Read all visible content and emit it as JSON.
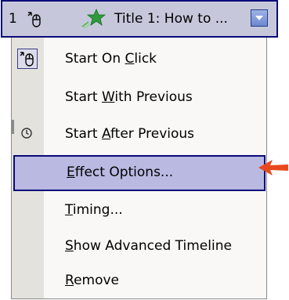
{
  "header": {
    "number": "1",
    "title": "Title 1: How to ..."
  },
  "menu": {
    "items": [
      {
        "label": "Start On Click",
        "mnemonic": "C"
      },
      {
        "label": "Start With Previous",
        "mnemonic": "W"
      },
      {
        "label": "Start After Previous",
        "mnemonic": "A"
      },
      {
        "label": "Effect Options...",
        "mnemonic": "E"
      },
      {
        "label": "Timing...",
        "mnemonic": "T"
      },
      {
        "label": "Show Advanced Timeline",
        "mnemonic": "S"
      },
      {
        "label": "Remove",
        "mnemonic": "R"
      }
    ]
  },
  "colors": {
    "selection_border": "#0a0a78",
    "highlight": "#b9b9e2",
    "menu_bg": "#f9f8f6",
    "gutter_bg": "#e4e2dd",
    "pointer_arrow": "#e8481f"
  },
  "icons": {
    "header_trigger": "mouse-click-icon",
    "header_effect": "green-star-effect-icon",
    "header_dropdown": "dropdown-arrow-icon",
    "start_on_click": "mouse-click-icon",
    "start_after_previous": "clock-icon",
    "pointer": "red-pointer-arrow-icon"
  }
}
